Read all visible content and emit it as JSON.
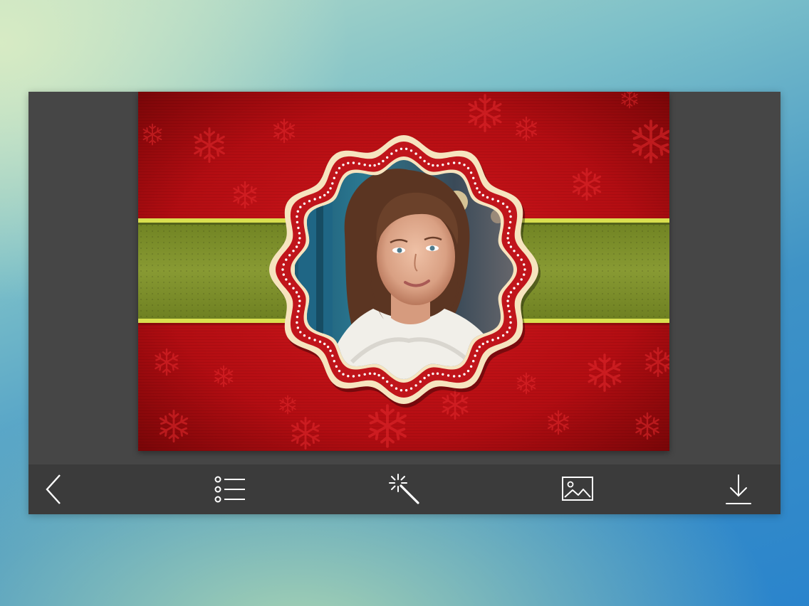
{
  "colors": {
    "frame_bg": "#454545",
    "toolbar_bg": "#3b3b3b",
    "card_red": "#b70d12",
    "band_green": "#7c8f2a",
    "band_trim": "#d9df4f",
    "badge_cream": "#f6e4bf",
    "badge_red": "#c0151b",
    "icon_color": "#ffffff"
  },
  "editor": {
    "frame_theme": "christmas-snowflake-badge-frame",
    "photo_subject": "woman-in-white-fur-collar"
  },
  "toolbar": {
    "items": [
      {
        "icon": "chevron-left-icon",
        "action": "back"
      },
      {
        "icon": "list-icon",
        "action": "frames-list"
      },
      {
        "icon": "magic-wand-icon",
        "action": "effects"
      },
      {
        "icon": "image-icon",
        "action": "gallery"
      },
      {
        "icon": "download-icon",
        "action": "save"
      }
    ]
  }
}
